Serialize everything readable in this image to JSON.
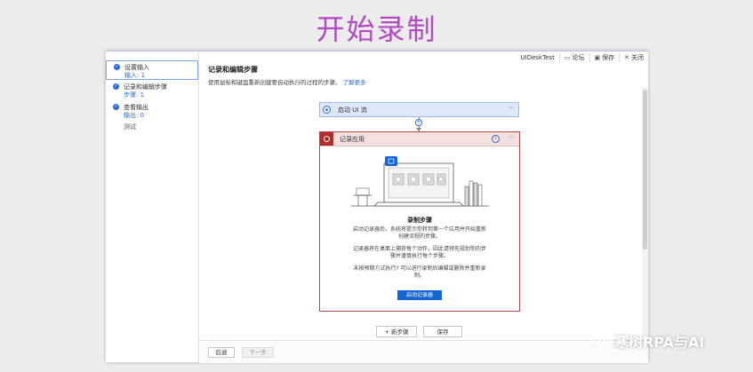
{
  "page_title": "开始录制",
  "window": {
    "app_name": "UIDeskTest",
    "forum_label": "论坛",
    "save_label": "保存",
    "close_label": "关闭"
  },
  "sidebar": {
    "steps": [
      {
        "title": "设置输入",
        "sub": "输入: 1"
      },
      {
        "title": "记录和编辑步骤",
        "sub": "步骤: 1"
      },
      {
        "title": "查看输出",
        "sub": "输出: 0"
      },
      {
        "title": "测试",
        "sub": ""
      }
    ]
  },
  "main": {
    "title": "记录和编辑步骤",
    "description": "使用鼠标和键盘重新创建要自动执行的过程的步骤。",
    "learn_more": "了解更多",
    "flow_card_label": "启动 UI 流",
    "more_dots": "···",
    "record_card": {
      "header": "记录应用",
      "title": "录制步骤",
      "para1": "启动记录器后，系统将提示你转到第一个应用并开始重新创建流程的步骤。",
      "para2": "记录器将在桌面上捕获每个动作，因此请预先规划你的步骤并谨慎执行每个步骤。",
      "para3": "未按预期方式执行? 可以进行录制后编辑或删除并重新录制。",
      "button": "启动记录器"
    },
    "add_step": "+ 新步骤",
    "save_button": "保存"
  },
  "footer": {
    "back": "后退",
    "next": "下一步"
  },
  "watermark": "寒树RPA与AI"
}
